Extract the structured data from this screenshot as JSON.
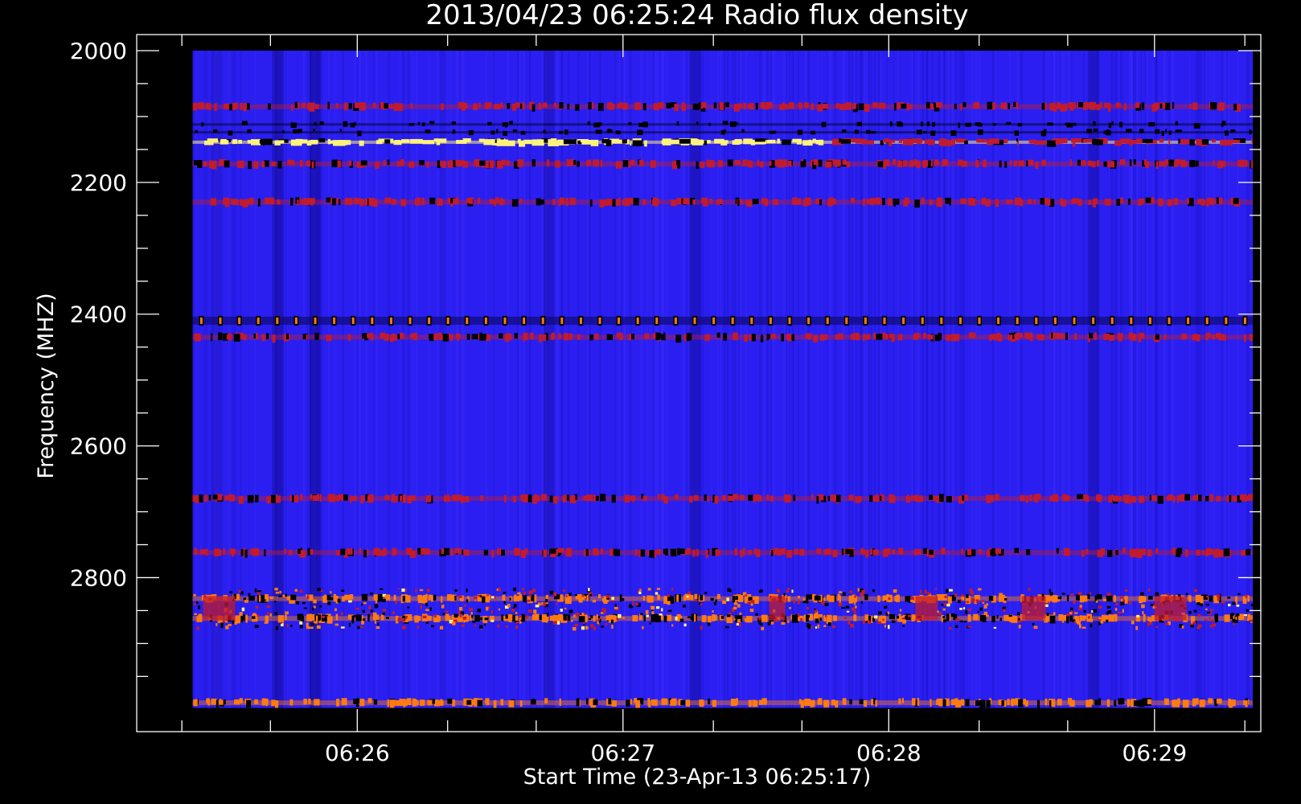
{
  "chart_data": {
    "type": "heatmap",
    "title": "2013/04/23 06:25:24 Radio flux density",
    "xlabel": "Start Time (23-Apr-13 06:25:17)",
    "ylabel": "Frequency (MHZ)",
    "x_ticks": [
      "06:26",
      "06:27",
      "06:28",
      "06:29"
    ],
    "y_ticks": [
      "2000",
      "2200",
      "2400",
      "2600",
      "2800"
    ],
    "ylim": [
      2000,
      3000
    ],
    "y_inverted": true,
    "xlim_minutes_from_0626": [
      -0.83,
      3.4
    ],
    "data_x_range_minutes_from_0626": [
      -0.62,
      3.37
    ],
    "data_y_range_mhz": [
      2000,
      2998
    ],
    "colors": {
      "background_flux": "#2a1ff0",
      "low_flux": "#000000",
      "medium_flux": "#c01b2e",
      "high_flux": "#ff7a10",
      "peak_flux": "#fff27a",
      "axes": "#ffffff"
    },
    "bands": [
      {
        "freq_mhz": 2085,
        "intensity": "medium",
        "pattern": "continuous"
      },
      {
        "freq_mhz": 2112,
        "intensity": "low",
        "pattern": "continuous"
      },
      {
        "freq_mhz": 2124,
        "intensity": "low",
        "pattern": "continuous"
      },
      {
        "freq_mhz": 2139,
        "intensity": "peak",
        "pattern": "continuous"
      },
      {
        "freq_mhz": 2172,
        "intensity": "medium",
        "pattern": "continuous"
      },
      {
        "freq_mhz": 2230,
        "intensity": "medium",
        "pattern": "continuous"
      },
      {
        "freq_mhz": 2410,
        "intensity": "high",
        "pattern": "dotted"
      },
      {
        "freq_mhz": 2435,
        "intensity": "medium",
        "pattern": "continuous"
      },
      {
        "freq_mhz": 2680,
        "intensity": "medium",
        "pattern": "continuous"
      },
      {
        "freq_mhz": 2762,
        "intensity": "medium",
        "pattern": "continuous"
      },
      {
        "freq_mhz": 2832,
        "intensity": "high",
        "pattern": "continuous"
      },
      {
        "freq_mhz": 2862,
        "intensity": "high",
        "pattern": "continuous"
      },
      {
        "freq_mhz": 2990,
        "intensity": "high",
        "pattern": "continuous"
      }
    ]
  }
}
